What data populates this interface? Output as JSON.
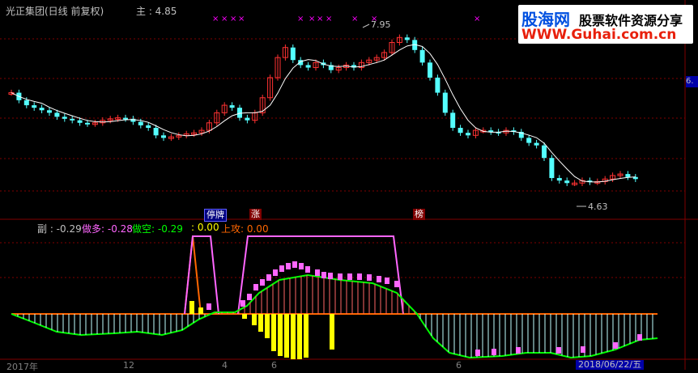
{
  "header": {
    "title": "光正集团(日线 前复权)",
    "main_label": "主 : 4.85"
  },
  "logo": {
    "text_cn_red": "股海网",
    "text_cn_black": "股票软件资源分享",
    "url": "WWW.Guhai.com.cn"
  },
  "price_annotations": {
    "high": "7.95",
    "low": "4.63"
  },
  "events": [
    {
      "label": "停牌",
      "kind": "suspend"
    },
    {
      "label": "涨",
      "kind": "limit"
    },
    {
      "label": "榜",
      "kind": "ranking"
    }
  ],
  "right_edge_label": "6.",
  "indicator": {
    "fu_label": "副 : -0.29",
    "zuoduo_label": "做多: -0.28",
    "zuokong_label": "做空: -0.29",
    "blank_label": ": 0.00",
    "shanggong_label": "上攻: 0.00"
  },
  "x_axis": {
    "ticks": [
      "2017年",
      "12",
      "4",
      "6",
      "6"
    ],
    "current_date": "2018/06/22/五"
  },
  "colors": {
    "background": "#000000",
    "up_candle": "#ff3232",
    "down_candle": "#54ffff",
    "ma_line": "#ffffff",
    "fu": "#c0c0c0",
    "zuoduo": "#ff66ff",
    "zuokong": "#00ff00",
    "shanggong": "#ff6600",
    "yellow_bar": "#ffff00",
    "grid_dash": "#7f0000"
  }
}
